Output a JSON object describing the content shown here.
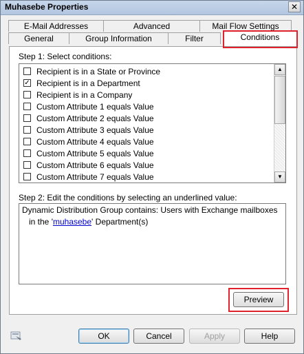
{
  "window": {
    "title": "Muhasebe Properties",
    "close_glyph": "✕"
  },
  "tabs_row1": [
    {
      "label": "E-Mail Addresses"
    },
    {
      "label": "Advanced"
    },
    {
      "label": "Mail Flow Settings"
    }
  ],
  "tabs_row2": [
    {
      "label": "General"
    },
    {
      "label": "Group Information"
    },
    {
      "label": "Filter"
    },
    {
      "label": "Conditions"
    }
  ],
  "active_tab": "Conditions",
  "step1": {
    "label": "Step 1: Select conditions:",
    "items": [
      {
        "label": "Recipient is in a State or Province",
        "checked": false
      },
      {
        "label": "Recipient is in a Department",
        "checked": true
      },
      {
        "label": "Recipient is in a Company",
        "checked": false
      },
      {
        "label": "Custom Attribute 1 equals Value",
        "checked": false
      },
      {
        "label": "Custom Attribute 2 equals Value",
        "checked": false
      },
      {
        "label": "Custom Attribute 3 equals Value",
        "checked": false
      },
      {
        "label": "Custom Attribute 4 equals Value",
        "checked": false
      },
      {
        "label": "Custom Attribute 5 equals Value",
        "checked": false
      },
      {
        "label": "Custom Attribute 6 equals Value",
        "checked": false
      },
      {
        "label": "Custom Attribute 7 equals Value",
        "checked": false
      }
    ]
  },
  "step2": {
    "label": "Step 2: Edit the conditions by selecting an underlined value:",
    "line1": "Dynamic Distribution Group contains: Users with Exchange mailboxes",
    "line2_prefix": "in the '",
    "line2_link": "muhasebe",
    "line2_suffix": "' Department(s)"
  },
  "buttons": {
    "preview": "Preview",
    "ok": "OK",
    "cancel": "Cancel",
    "apply": "Apply",
    "help": "Help"
  },
  "icons": {
    "help": "help-icon",
    "scroll_up": "▲",
    "scroll_down": "▼",
    "check": "✓"
  },
  "colors": {
    "highlight": "#e0202a",
    "link": "#0000cc"
  }
}
